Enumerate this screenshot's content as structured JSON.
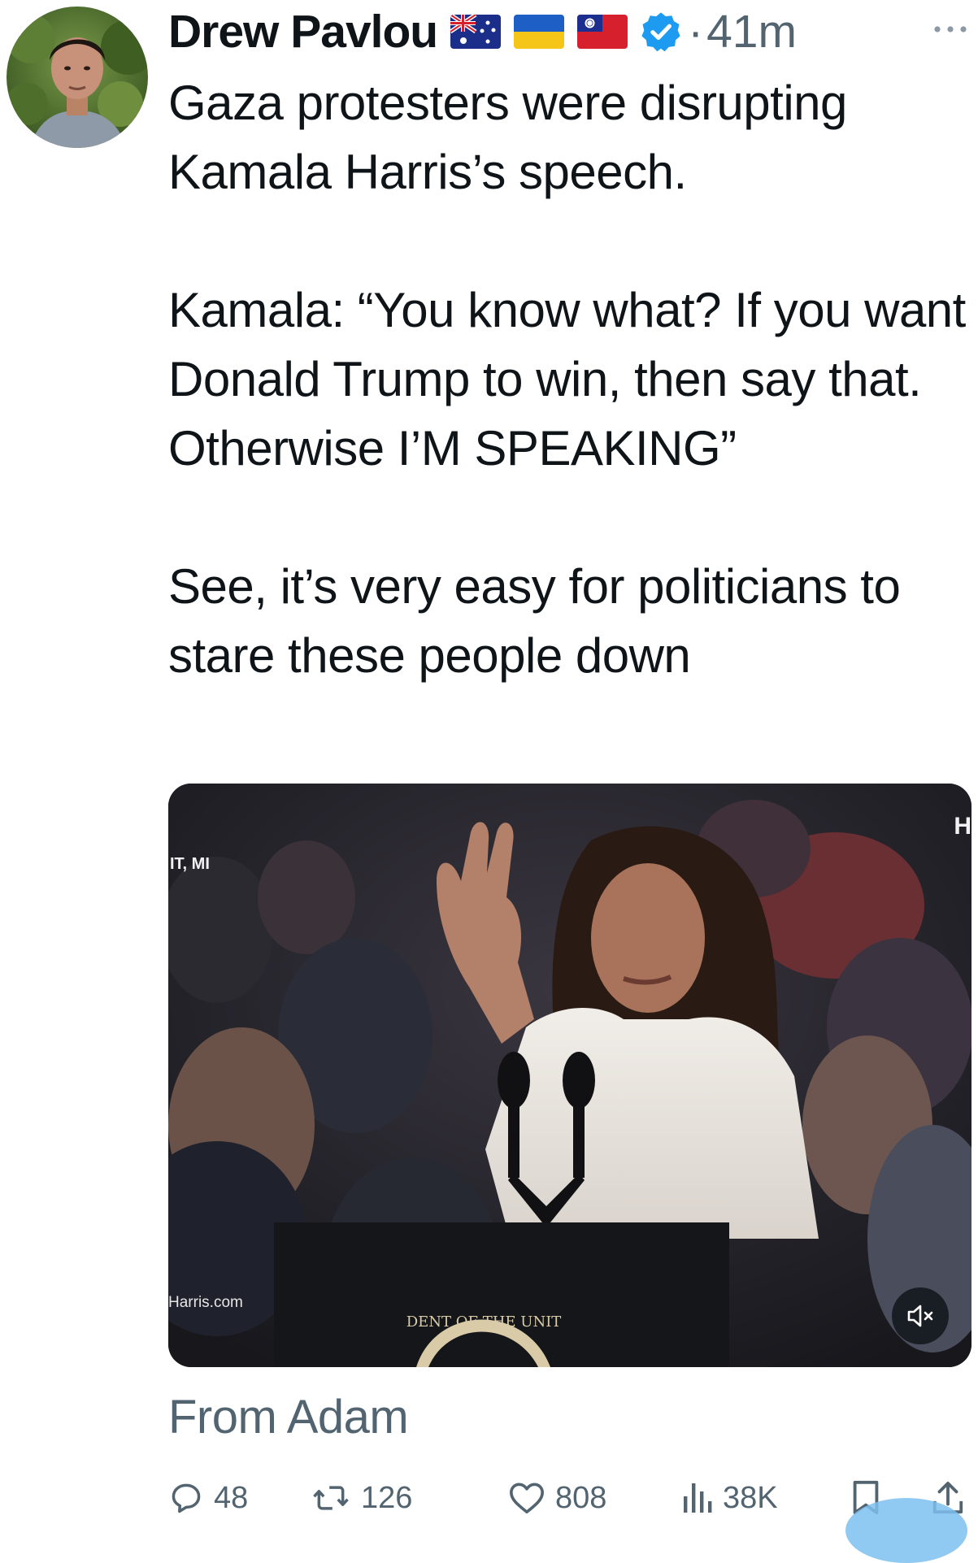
{
  "tweet": {
    "author": {
      "name": "Drew Pavlou",
      "flags": [
        "australia-flag",
        "ukraine-flag",
        "taiwan-flag"
      ],
      "verified": true
    },
    "separator": "·",
    "timestamp": "41m",
    "text": "Gaza protesters were disrupting Kamala Harris’s speech.\n\nKamala: “You know what? If you want Donald Trump to win, then say that. Otherwise I’M SPEAKING”\n\nSee, it’s very easy for politicians to stare these people down",
    "media": {
      "type": "video",
      "overlay_location": "IT, MI",
      "overlay_site": "Harris.com",
      "overlay_right": "H",
      "seal_text": "DENT OF THE UNIT",
      "muted": true
    },
    "caption": "From Adam",
    "stats": {
      "replies": "48",
      "reposts": "126",
      "likes": "808",
      "views": "38K"
    }
  },
  "colors": {
    "text_primary": "#0f1419",
    "text_secondary": "#536471",
    "verified_blue": "#1d9bf0"
  },
  "icons": {
    "more": "more-horizontal-icon",
    "verified": "verified-badge-icon",
    "mute": "volume-muted-icon",
    "reply": "reply-icon",
    "repost": "repost-icon",
    "like": "heart-icon",
    "views": "views-chart-icon",
    "bookmark": "bookmark-icon",
    "share": "share-icon"
  }
}
